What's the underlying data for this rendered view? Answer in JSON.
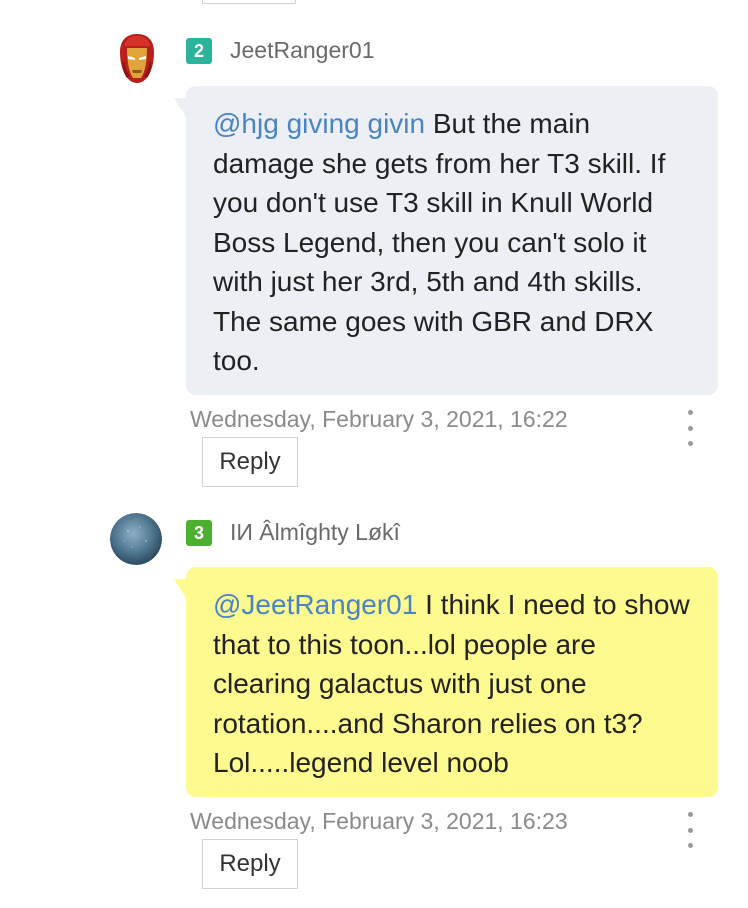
{
  "comments": [
    {
      "level": "2",
      "level_color": "#2bb39b",
      "username": "JeetRanger01",
      "avatar_icon": "iron-man-helmet",
      "bubble_color": "#eceff3",
      "mention": "@hjg giving givin",
      "text": " But the main damage she gets from her T3 skill. If you don't use T3 skill in Knull World Boss Legend, then you can't solo it with just her 3rd, 5th and 4th skills. The same goes with GBR and DRX too.",
      "timestamp": "Wednesday, February 3, 2021, 16:22",
      "reply_label": "Reply"
    },
    {
      "level": "3",
      "level_color": "#4caf2f",
      "username": "IИ Âlmîghty Løkî",
      "avatar_icon": "blue-sphere-avatar",
      "bubble_color": "#fdfa8f",
      "mention": "@JeetRanger01",
      "text": " I think I need to show that to this toon...lol people are clearing galactus with just one rotation....and Sharon relies on t3? Lol.....legend level noob",
      "timestamp": "Wednesday, February 3, 2021, 16:23",
      "reply_label": "Reply"
    }
  ],
  "more_icon": "vertical-ellipsis-icon"
}
